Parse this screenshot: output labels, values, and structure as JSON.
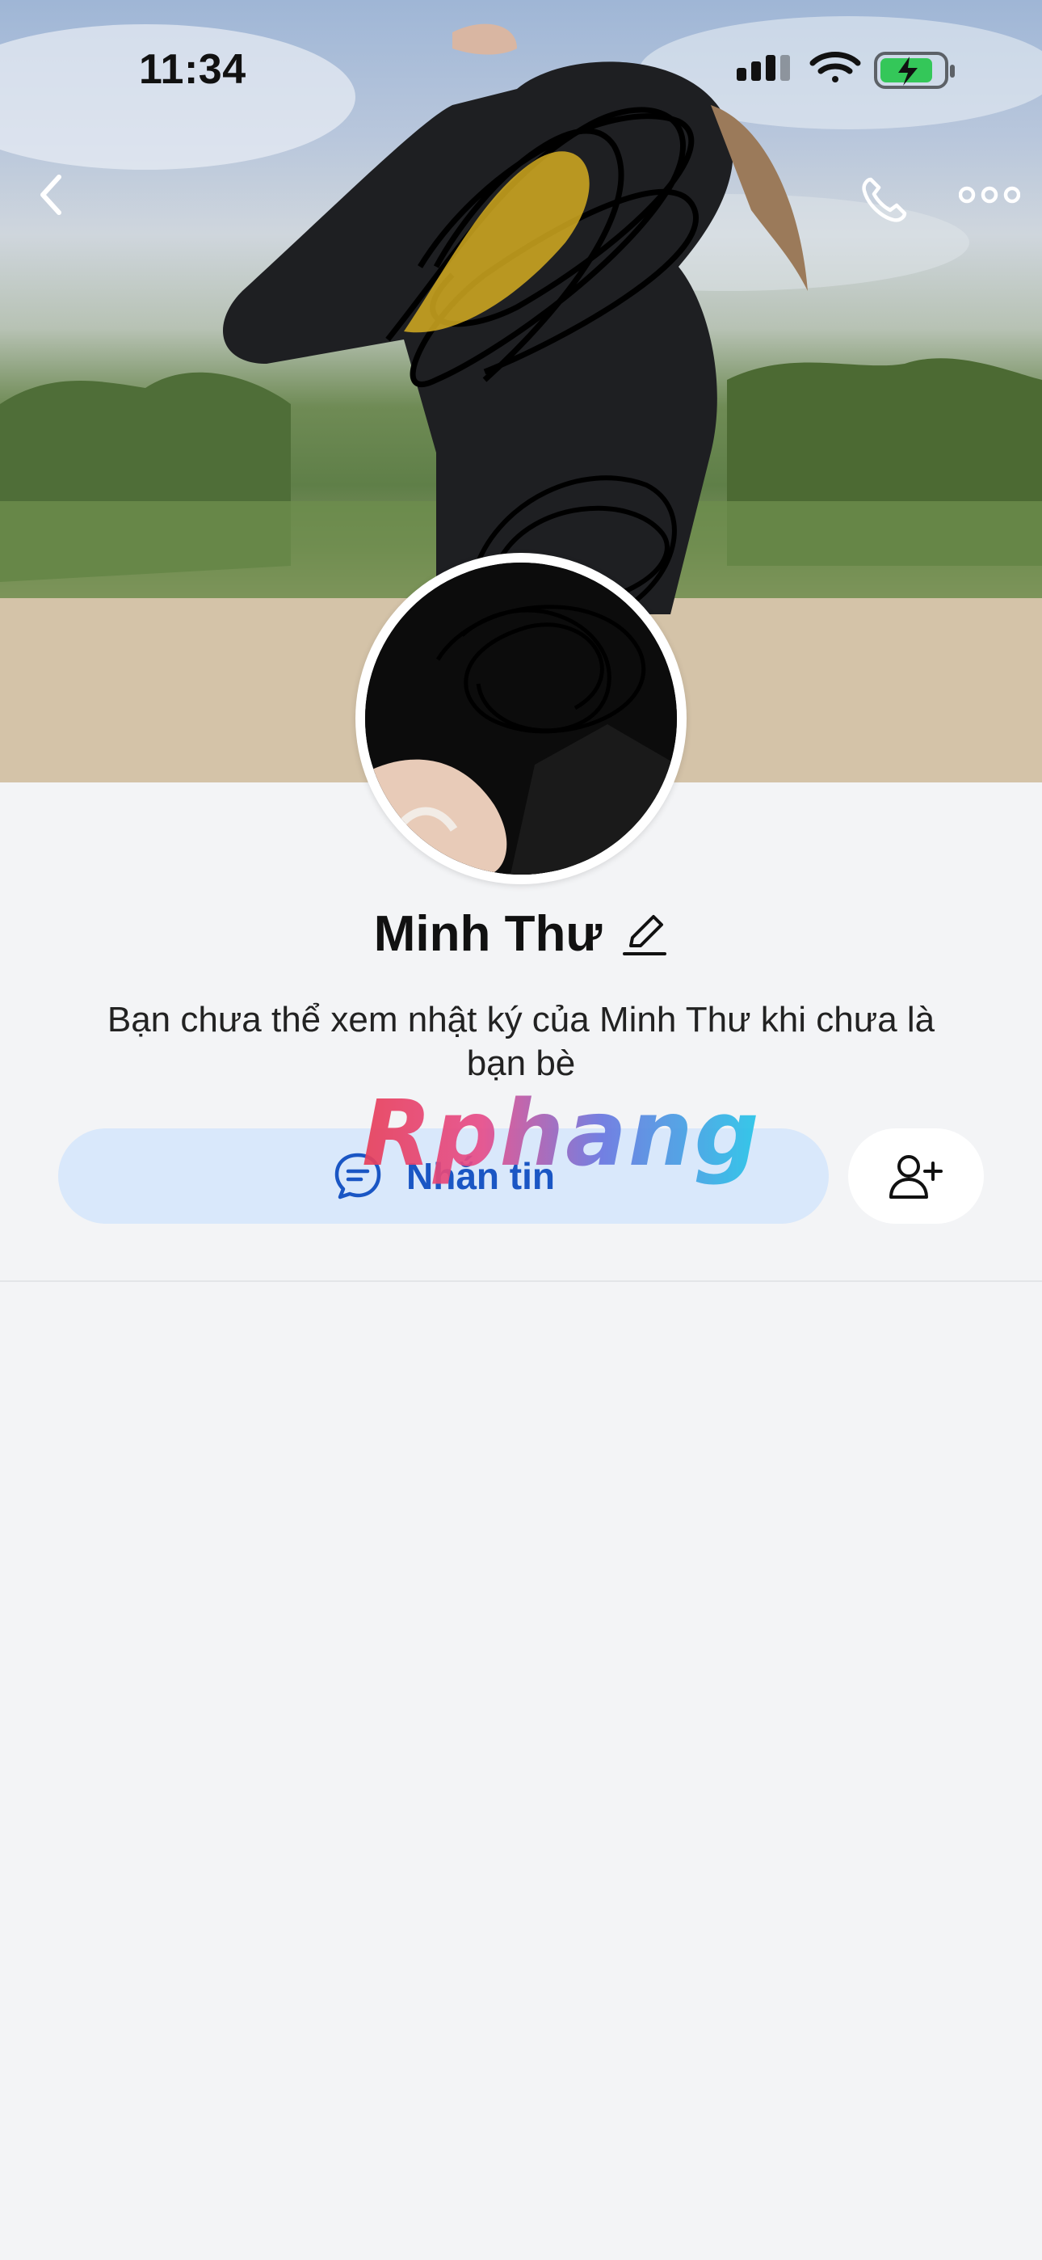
{
  "status_bar": {
    "time": "11:34"
  },
  "header": {
    "back_icon": "chevron-left-icon",
    "call_icon": "phone-icon",
    "more_icon": "more-horizontal-icon"
  },
  "profile": {
    "name": "Minh Thư",
    "edit_icon": "pencil-icon",
    "notice": "Bạn chưa thể xem nhật ký của Minh Thư khi chưa là bạn bè"
  },
  "actions": {
    "message_label": "Nhắn tin",
    "message_icon": "chat-bubble-icon",
    "add_friend_icon": "user-plus-icon"
  },
  "watermark": {
    "text": "Rphang"
  },
  "colors": {
    "background": "#f3f4f6",
    "message_button_bg": "#d9e8fb",
    "accent": "#1a56c4",
    "battery_green": "#34c759"
  }
}
